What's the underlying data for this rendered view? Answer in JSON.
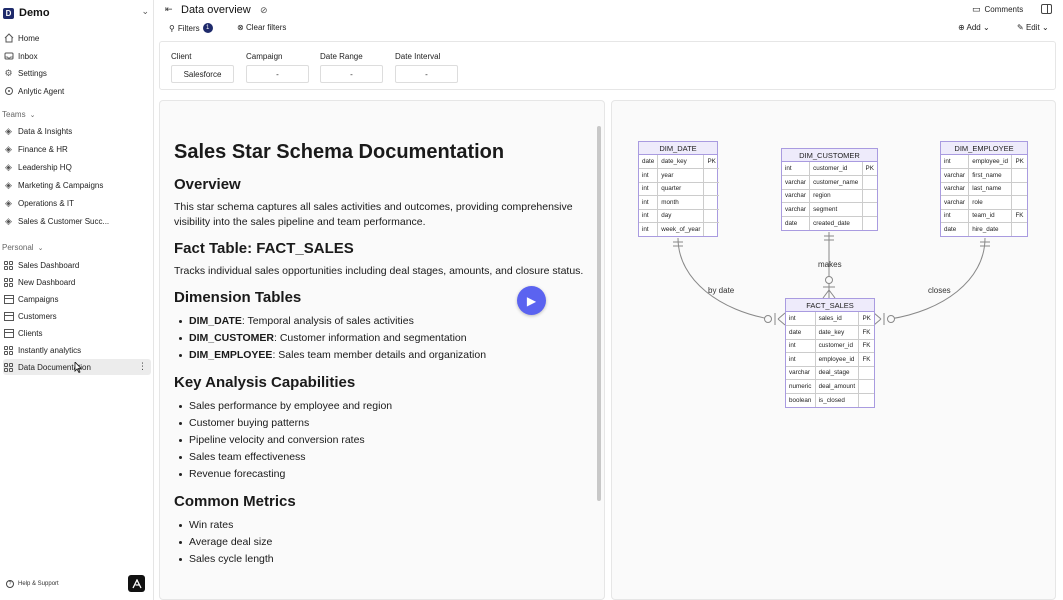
{
  "workspace": {
    "initial": "D",
    "name": "Demo"
  },
  "nav_main": [
    {
      "label": "Home",
      "icon": "home-icon"
    },
    {
      "label": "Inbox",
      "icon": "inbox-icon"
    },
    {
      "label": "Settings",
      "icon": "gear-icon"
    },
    {
      "label": "Anlytic Agent",
      "icon": "agent-icon"
    }
  ],
  "teams": {
    "label": "Teams",
    "items": [
      "Data & Insights",
      "Finance & HR",
      "Leadership HQ",
      "Marketing & Campaigns",
      "Operations & IT",
      "Sales & Customer Succ..."
    ]
  },
  "personal": {
    "label": "Personal",
    "items": [
      "Sales Dashboard",
      "New Dashboard",
      "Campaigns",
      "Customers",
      "Clients",
      "Instantly analytics",
      "Data Documentation"
    ],
    "active_index": 6
  },
  "help_label": "Help & Support",
  "header": {
    "title": "Data overview",
    "comments_label": "Comments"
  },
  "toolbar": {
    "filters_label": "Filters",
    "filters_count": "1",
    "clear_label": "Clear filters",
    "add_label": "Add",
    "edit_label": "Edit"
  },
  "filters": [
    {
      "label": "Client",
      "value": "Salesforce"
    },
    {
      "label": "Campaign",
      "value": "-"
    },
    {
      "label": "Date Range",
      "value": "-"
    },
    {
      "label": "Date Interval",
      "value": "-"
    }
  ],
  "doc": {
    "title": "Sales Star Schema Documentation",
    "overview_heading": "Overview",
    "overview_text": "This star schema captures all sales activities and outcomes, providing comprehensive visibility into the sales pipeline and team performance.",
    "fact_heading": "Fact Table: FACT_SALES",
    "fact_text": "Tracks individual sales opportunities including deal stages, amounts, and closure status.",
    "dim_heading": "Dimension Tables",
    "dims": [
      {
        "name": "DIM_DATE",
        "desc": ": Temporal analysis of sales activities"
      },
      {
        "name": "DIM_CUSTOMER",
        "desc": ": Customer information and segmentation"
      },
      {
        "name": "DIM_EMPLOYEE",
        "desc": ": Sales team member details and organization"
      }
    ],
    "kac_heading": "Key Analysis Capabilities",
    "kac": [
      "Sales performance by employee and region",
      "Customer buying patterns",
      "Pipeline velocity and conversion rates",
      "Sales team effectiveness",
      "Revenue forecasting"
    ],
    "metrics_heading": "Common Metrics",
    "metrics": [
      "Win rates",
      "Average deal size",
      "Sales cycle length"
    ]
  },
  "diagram": {
    "entities": {
      "dim_date": {
        "name": "DIM_DATE",
        "rows": [
          [
            "date",
            "date_key",
            "PK"
          ],
          [
            "int",
            "year",
            ""
          ],
          [
            "int",
            "quarter",
            ""
          ],
          [
            "int",
            "month",
            ""
          ],
          [
            "int",
            "day",
            ""
          ],
          [
            "int",
            "week_of_year",
            ""
          ]
        ]
      },
      "dim_customer": {
        "name": "DIM_CUSTOMER",
        "rows": [
          [
            "int",
            "customer_id",
            "PK"
          ],
          [
            "varchar",
            "customer_name",
            ""
          ],
          [
            "varchar",
            "region",
            ""
          ],
          [
            "varchar",
            "segment",
            ""
          ],
          [
            "date",
            "created_date",
            ""
          ]
        ]
      },
      "dim_employee": {
        "name": "DIM_EMPLOYEE",
        "rows": [
          [
            "int",
            "employee_id",
            "PK"
          ],
          [
            "varchar",
            "first_name",
            ""
          ],
          [
            "varchar",
            "last_name",
            ""
          ],
          [
            "varchar",
            "role",
            ""
          ],
          [
            "int",
            "team_id",
            "FK"
          ],
          [
            "date",
            "hire_date",
            ""
          ]
        ]
      },
      "fact_sales": {
        "name": "FACT_SALES",
        "rows": [
          [
            "int",
            "sales_id",
            "PK"
          ],
          [
            "date",
            "date_key",
            "FK"
          ],
          [
            "int",
            "customer_id",
            "FK"
          ],
          [
            "int",
            "employee_id",
            "FK"
          ],
          [
            "varchar",
            "deal_stage",
            ""
          ],
          [
            "numeric",
            "deal_amount",
            ""
          ],
          [
            "boolean",
            "is_closed",
            ""
          ]
        ]
      }
    },
    "relations": {
      "by_date": "by date",
      "makes": "makes",
      "closes": "closes"
    },
    "colors": {
      "entity_border": "#a99be0",
      "entity_header": "#eeebfb",
      "line": "#888888"
    }
  },
  "colors": {
    "play_button": "#5b63f0",
    "workspace_logo": "#1e2a6b"
  }
}
